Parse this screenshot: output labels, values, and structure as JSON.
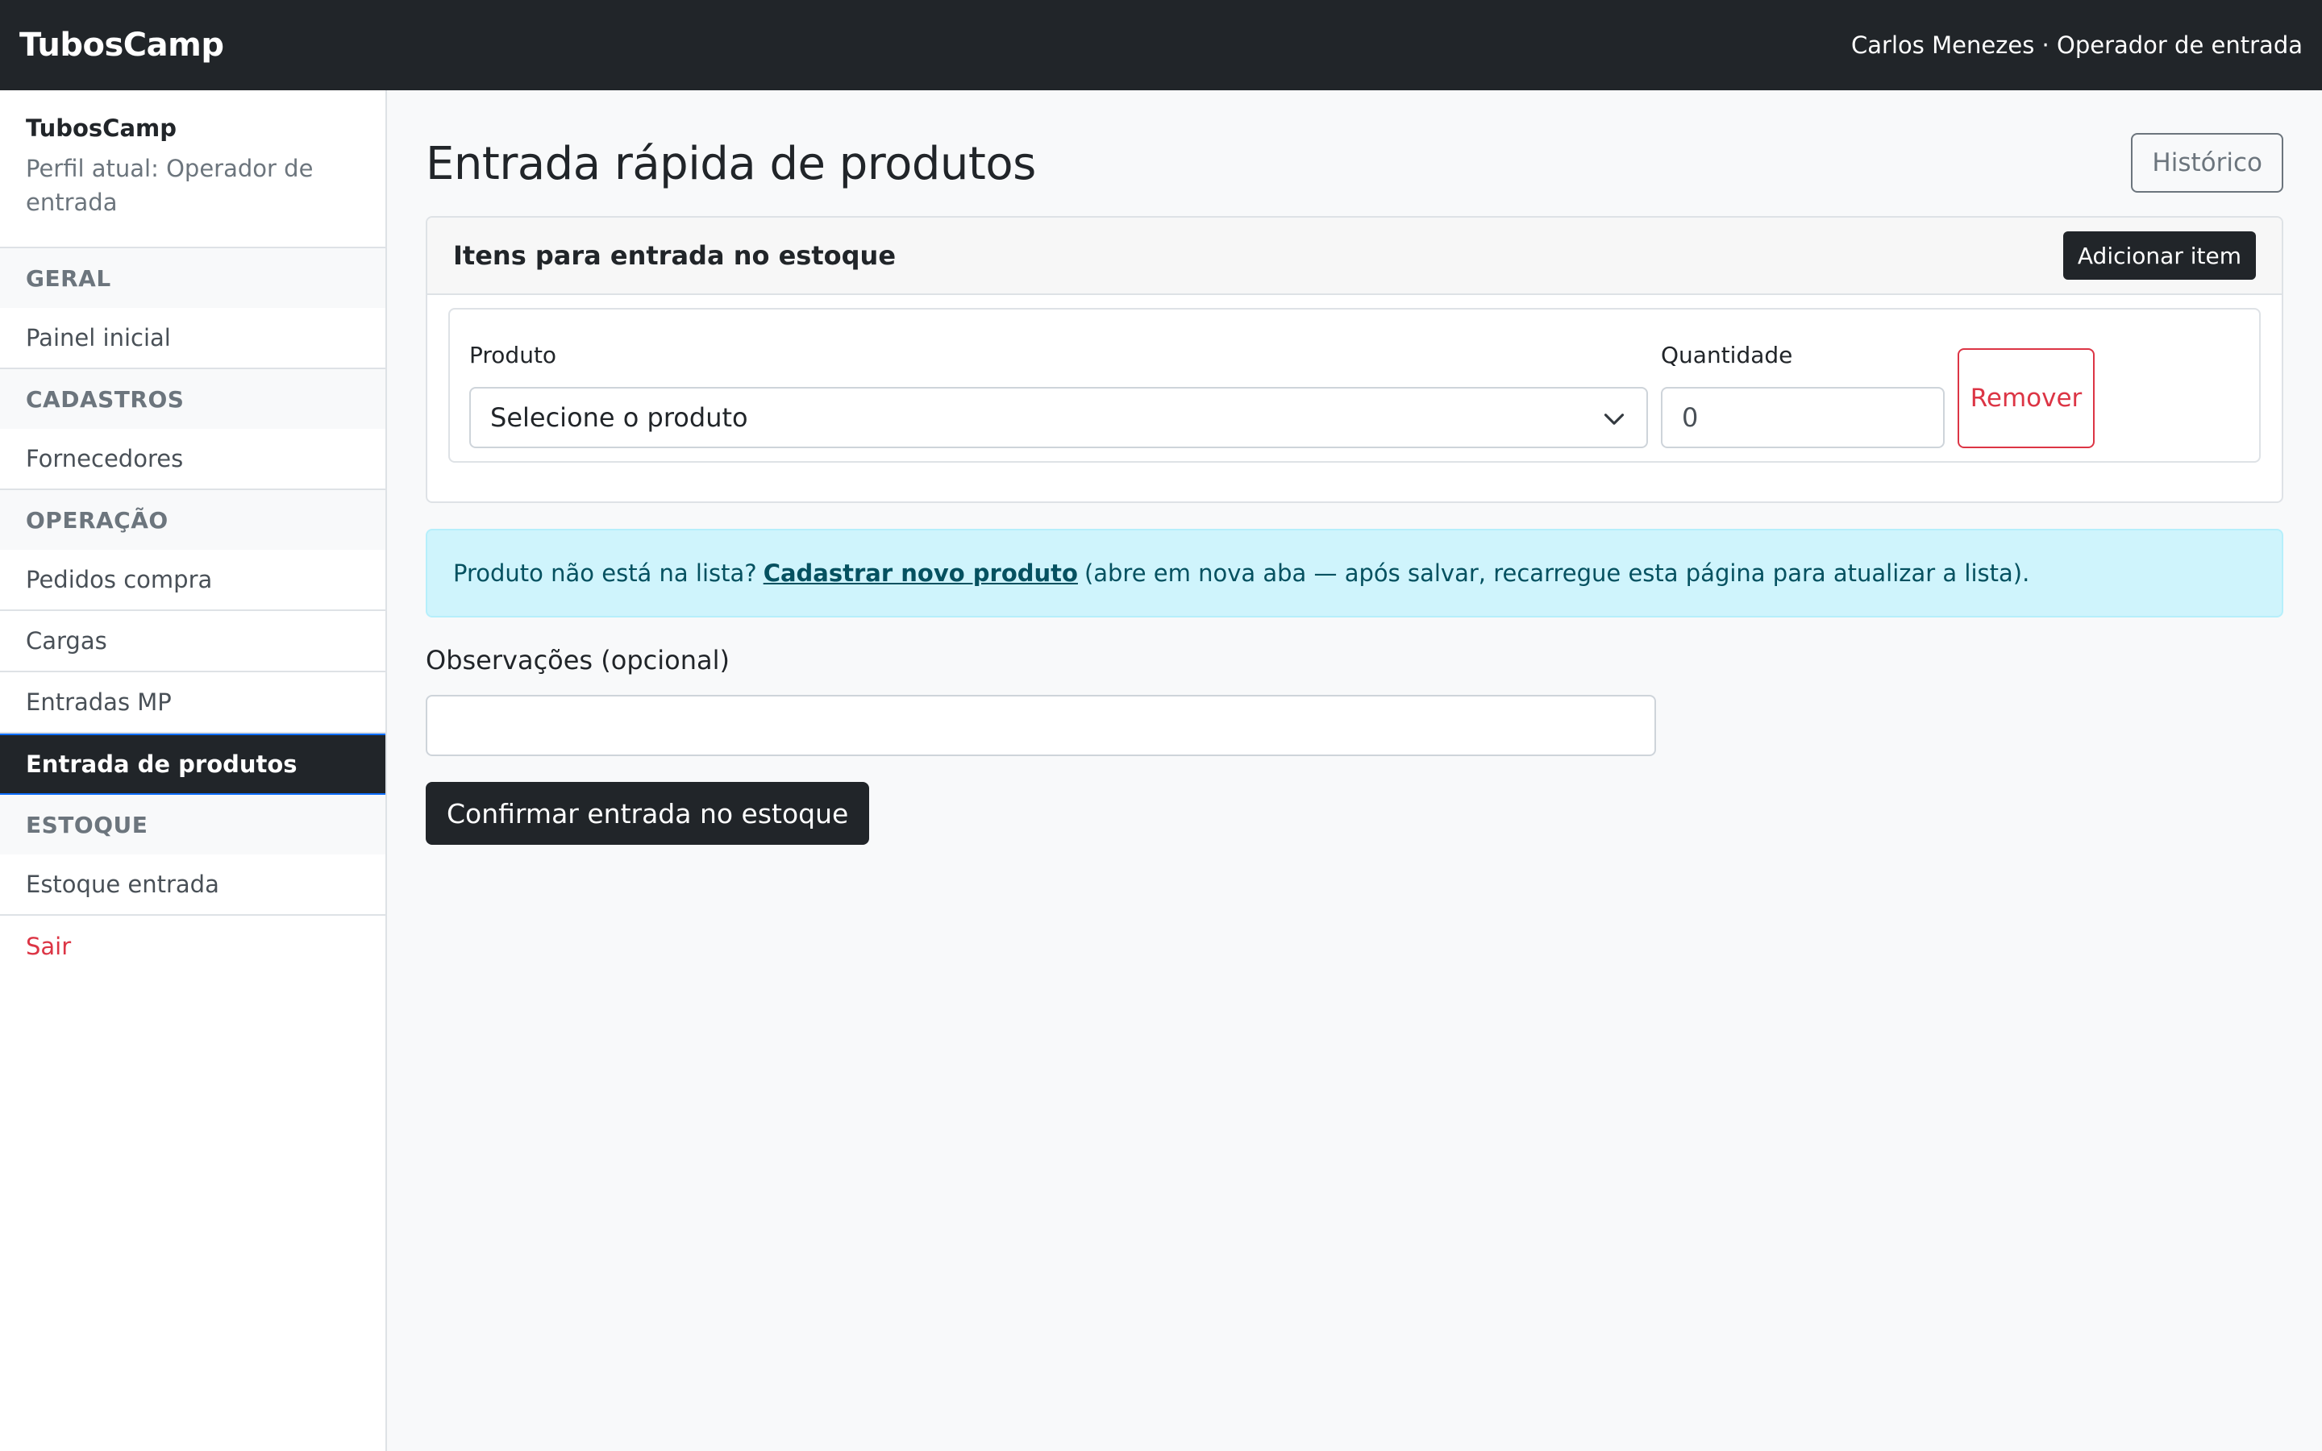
{
  "topbar": {
    "brand": "TubosCamp",
    "user": "Carlos Menezes · Operador de entrada"
  },
  "sidebar": {
    "app_name": "TubosCamp",
    "profile": "Perfil atual: Operador de entrada",
    "sections": [
      {
        "title": "GERAL",
        "items": [
          "Painel inicial"
        ]
      },
      {
        "title": "CADASTROS",
        "items": [
          "Fornecedores"
        ]
      },
      {
        "title": "OPERAÇÃO",
        "items": [
          "Pedidos compra",
          "Cargas",
          "Entradas MP",
          "Entrada de produtos"
        ]
      },
      {
        "title": "ESTOQUE",
        "items": [
          "Estoque entrada"
        ]
      }
    ],
    "active_item": "Entrada de produtos",
    "logout": "Sair"
  },
  "page": {
    "title": "Entrada rápida de produtos",
    "history_button": "Histórico"
  },
  "items_card": {
    "title": "Itens para entrada no estoque",
    "add_button": "Adicionar item",
    "product_label": "Produto",
    "product_selected": "Selecione o produto",
    "quantity_label": "Quantidade",
    "quantity_value": "0",
    "remove_button": "Remover"
  },
  "alert": {
    "prefix": "Produto não está na lista?",
    "link": "Cadastrar novo produto",
    "suffix": "(abre em nova aba — após salvar, recarregue esta página para atualizar a lista)."
  },
  "notes": {
    "label": "Observações (opcional)",
    "value": ""
  },
  "confirm_button": "Confirmar entrada no estoque",
  "colors": {
    "dark": "#212529",
    "danger": "#dc3545",
    "info_bg": "#cff4fc",
    "info_text": "#055160",
    "active_border": "#0d6efd"
  }
}
